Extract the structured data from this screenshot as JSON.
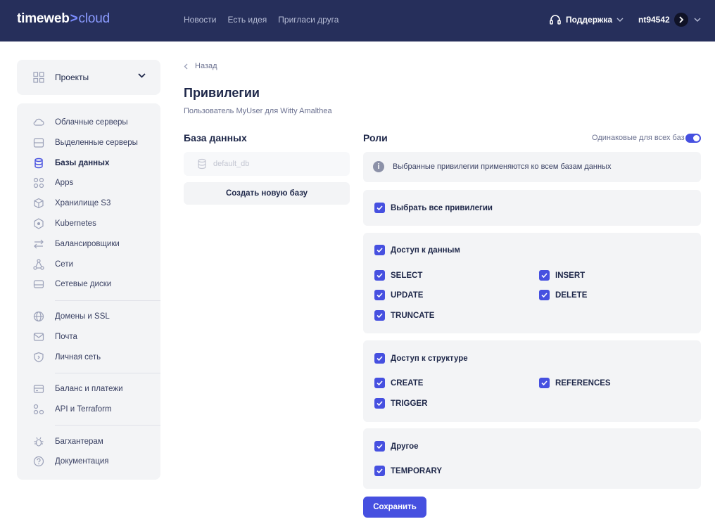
{
  "header": {
    "logo_main": "timeweb",
    "logo_sep": ">",
    "logo_suffix": "cloud",
    "nav": [
      "Новости",
      "Есть идея",
      "Пригласи друга"
    ],
    "support_label": "Поддержка",
    "username": "nt94542"
  },
  "sidebar": {
    "projects_label": "Проекты",
    "items": [
      {
        "label": "Облачные серверы",
        "icon": "cloud-icon"
      },
      {
        "label": "Выделенные серверы",
        "icon": "server-icon"
      },
      {
        "label": "Базы данных",
        "icon": "database-icon",
        "active": true
      },
      {
        "label": "Apps",
        "icon": "apps-icon"
      },
      {
        "label": "Хранилище S3",
        "icon": "cube-icon"
      },
      {
        "label": "Kubernetes",
        "icon": "kubernetes-icon"
      },
      {
        "label": "Балансировщики",
        "icon": "arrows-icon"
      },
      {
        "label": "Сети",
        "icon": "network-icon"
      },
      {
        "label": "Сетевые диски",
        "icon": "disk-icon"
      },
      {
        "label": "Домены и SSL",
        "icon": "globe-icon"
      },
      {
        "label": "Почта",
        "icon": "mail-icon"
      },
      {
        "label": "Личная сеть",
        "icon": "shield-icon"
      },
      {
        "label": "Баланс и платежи",
        "icon": "wallet-icon"
      },
      {
        "label": "API и Terraform",
        "icon": "api-icon"
      },
      {
        "label": "Багхантерам",
        "icon": "bug-icon"
      },
      {
        "label": "Документация",
        "icon": "help-icon"
      }
    ]
  },
  "main": {
    "back_label": "Назад",
    "title": "Привилегии",
    "subtitle": "Пользователь MyUser для Witty Amalthea",
    "db_heading": "База данных",
    "db_item": "default_db",
    "create_db_label": "Создать новую базу",
    "roles_heading": "Роли",
    "same_for_all_label": "Одинаковые для всех баз",
    "info_text": "Выбранные привилегии применяются ко всем базам данных",
    "select_all_label": "Выбрать все привилегии",
    "groups": {
      "data_access": {
        "label": "Доступ к данным",
        "items": [
          "SELECT",
          "INSERT",
          "UPDATE",
          "DELETE",
          "TRUNCATE"
        ]
      },
      "structure_access": {
        "label": "Доступ к структуре",
        "items": [
          "CREATE",
          "REFERENCES",
          "TRIGGER"
        ]
      },
      "other": {
        "label": "Другое",
        "items": [
          "TEMPORARY"
        ]
      }
    },
    "save_label": "Сохранить"
  },
  "colors": {
    "header_bg": "#262f5b",
    "accent": "#4650e0",
    "panel_bg": "#f3f4f6"
  }
}
